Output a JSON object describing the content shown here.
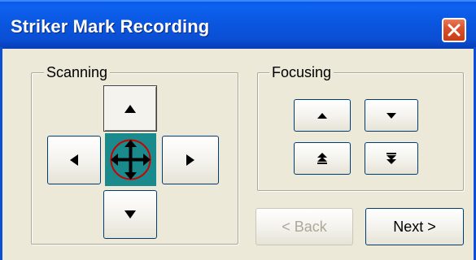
{
  "window": {
    "title": "Striker Mark Recording"
  },
  "scanning": {
    "label": "Scanning"
  },
  "focusing": {
    "label": "Focusing"
  },
  "navigation": {
    "back_label": "< Back",
    "next_label": "Next >"
  },
  "colors": {
    "title_bar": "#0a55de",
    "center_pad": "#1a8a8c",
    "close_button": "#d9532d",
    "crosshair_ring": "#cc0000"
  }
}
